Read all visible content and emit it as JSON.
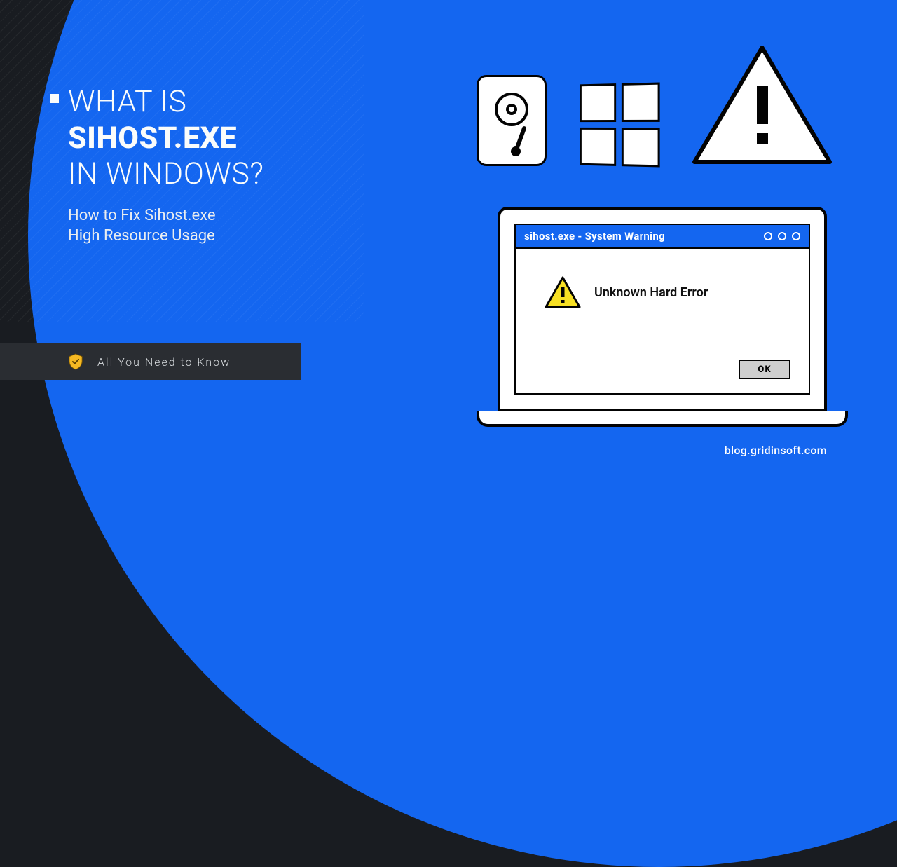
{
  "title": {
    "line1": "WHAT IS",
    "line2_bold": "SIHOST.EXE",
    "line3": "IN WINDOWS?"
  },
  "subtitle": {
    "line1": "How to Fix Sihost.exe",
    "line2": "High Resource Usage"
  },
  "badge": {
    "text": "All You Need to Know"
  },
  "dialog": {
    "title": "sihost.exe - System Warning",
    "message": "Unknown Hard Error",
    "ok_label": "OK"
  },
  "footer": {
    "url": "blog.gridinsoft.com"
  },
  "colors": {
    "blue": "#1466f0",
    "dark": "#191c21",
    "badge_bg": "#2a2d32",
    "warning_yellow": "#f6df23"
  },
  "icons": {
    "hdd": "hard-drive-icon",
    "windows": "windows-logo-icon",
    "warning_large": "warning-triangle-icon",
    "warning_small": "warning-triangle-small-icon",
    "shield": "shield-check-icon"
  }
}
